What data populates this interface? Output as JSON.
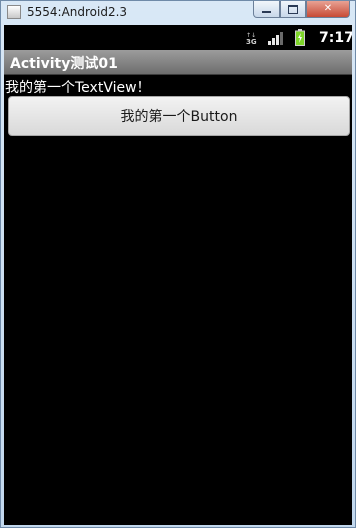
{
  "window": {
    "title": "5554:Android2.3"
  },
  "status_bar": {
    "network_icon": "3g-data-icon",
    "signal_icon": "signal-strength-icon",
    "battery_icon": "battery-charging-icon",
    "time": "7:17"
  },
  "activity": {
    "title": "Activity测试01",
    "text_view": "我的第一个TextView！",
    "button_label": "我的第一个Button"
  },
  "colors": {
    "screen_background": "#000000",
    "title_bar": "#8a8a8a",
    "battery_green": "#7fd62a"
  }
}
